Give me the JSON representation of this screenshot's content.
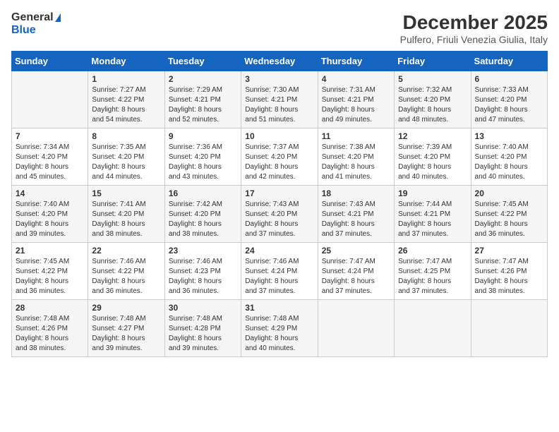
{
  "logo": {
    "line1": "General",
    "line2": "Blue"
  },
  "title": "December 2025",
  "subtitle": "Pulfero, Friuli Venezia Giulia, Italy",
  "days_header": [
    "Sunday",
    "Monday",
    "Tuesday",
    "Wednesday",
    "Thursday",
    "Friday",
    "Saturday"
  ],
  "weeks": [
    [
      {
        "day": "",
        "info": ""
      },
      {
        "day": "1",
        "info": "Sunrise: 7:27 AM\nSunset: 4:22 PM\nDaylight: 8 hours\nand 54 minutes."
      },
      {
        "day": "2",
        "info": "Sunrise: 7:29 AM\nSunset: 4:21 PM\nDaylight: 8 hours\nand 52 minutes."
      },
      {
        "day": "3",
        "info": "Sunrise: 7:30 AM\nSunset: 4:21 PM\nDaylight: 8 hours\nand 51 minutes."
      },
      {
        "day": "4",
        "info": "Sunrise: 7:31 AM\nSunset: 4:21 PM\nDaylight: 8 hours\nand 49 minutes."
      },
      {
        "day": "5",
        "info": "Sunrise: 7:32 AM\nSunset: 4:20 PM\nDaylight: 8 hours\nand 48 minutes."
      },
      {
        "day": "6",
        "info": "Sunrise: 7:33 AM\nSunset: 4:20 PM\nDaylight: 8 hours\nand 47 minutes."
      }
    ],
    [
      {
        "day": "7",
        "info": "Sunrise: 7:34 AM\nSunset: 4:20 PM\nDaylight: 8 hours\nand 45 minutes."
      },
      {
        "day": "8",
        "info": "Sunrise: 7:35 AM\nSunset: 4:20 PM\nDaylight: 8 hours\nand 44 minutes."
      },
      {
        "day": "9",
        "info": "Sunrise: 7:36 AM\nSunset: 4:20 PM\nDaylight: 8 hours\nand 43 minutes."
      },
      {
        "day": "10",
        "info": "Sunrise: 7:37 AM\nSunset: 4:20 PM\nDaylight: 8 hours\nand 42 minutes."
      },
      {
        "day": "11",
        "info": "Sunrise: 7:38 AM\nSunset: 4:20 PM\nDaylight: 8 hours\nand 41 minutes."
      },
      {
        "day": "12",
        "info": "Sunrise: 7:39 AM\nSunset: 4:20 PM\nDaylight: 8 hours\nand 40 minutes."
      },
      {
        "day": "13",
        "info": "Sunrise: 7:40 AM\nSunset: 4:20 PM\nDaylight: 8 hours\nand 40 minutes."
      }
    ],
    [
      {
        "day": "14",
        "info": "Sunrise: 7:40 AM\nSunset: 4:20 PM\nDaylight: 8 hours\nand 39 minutes."
      },
      {
        "day": "15",
        "info": "Sunrise: 7:41 AM\nSunset: 4:20 PM\nDaylight: 8 hours\nand 38 minutes."
      },
      {
        "day": "16",
        "info": "Sunrise: 7:42 AM\nSunset: 4:20 PM\nDaylight: 8 hours\nand 38 minutes."
      },
      {
        "day": "17",
        "info": "Sunrise: 7:43 AM\nSunset: 4:20 PM\nDaylight: 8 hours\nand 37 minutes."
      },
      {
        "day": "18",
        "info": "Sunrise: 7:43 AM\nSunset: 4:21 PM\nDaylight: 8 hours\nand 37 minutes."
      },
      {
        "day": "19",
        "info": "Sunrise: 7:44 AM\nSunset: 4:21 PM\nDaylight: 8 hours\nand 37 minutes."
      },
      {
        "day": "20",
        "info": "Sunrise: 7:45 AM\nSunset: 4:22 PM\nDaylight: 8 hours\nand 36 minutes."
      }
    ],
    [
      {
        "day": "21",
        "info": "Sunrise: 7:45 AM\nSunset: 4:22 PM\nDaylight: 8 hours\nand 36 minutes."
      },
      {
        "day": "22",
        "info": "Sunrise: 7:46 AM\nSunset: 4:22 PM\nDaylight: 8 hours\nand 36 minutes."
      },
      {
        "day": "23",
        "info": "Sunrise: 7:46 AM\nSunset: 4:23 PM\nDaylight: 8 hours\nand 36 minutes."
      },
      {
        "day": "24",
        "info": "Sunrise: 7:46 AM\nSunset: 4:24 PM\nDaylight: 8 hours\nand 37 minutes."
      },
      {
        "day": "25",
        "info": "Sunrise: 7:47 AM\nSunset: 4:24 PM\nDaylight: 8 hours\nand 37 minutes."
      },
      {
        "day": "26",
        "info": "Sunrise: 7:47 AM\nSunset: 4:25 PM\nDaylight: 8 hours\nand 37 minutes."
      },
      {
        "day": "27",
        "info": "Sunrise: 7:47 AM\nSunset: 4:26 PM\nDaylight: 8 hours\nand 38 minutes."
      }
    ],
    [
      {
        "day": "28",
        "info": "Sunrise: 7:48 AM\nSunset: 4:26 PM\nDaylight: 8 hours\nand 38 minutes."
      },
      {
        "day": "29",
        "info": "Sunrise: 7:48 AM\nSunset: 4:27 PM\nDaylight: 8 hours\nand 39 minutes."
      },
      {
        "day": "30",
        "info": "Sunrise: 7:48 AM\nSunset: 4:28 PM\nDaylight: 8 hours\nand 39 minutes."
      },
      {
        "day": "31",
        "info": "Sunrise: 7:48 AM\nSunset: 4:29 PM\nDaylight: 8 hours\nand 40 minutes."
      },
      {
        "day": "",
        "info": ""
      },
      {
        "day": "",
        "info": ""
      },
      {
        "day": "",
        "info": ""
      }
    ]
  ]
}
